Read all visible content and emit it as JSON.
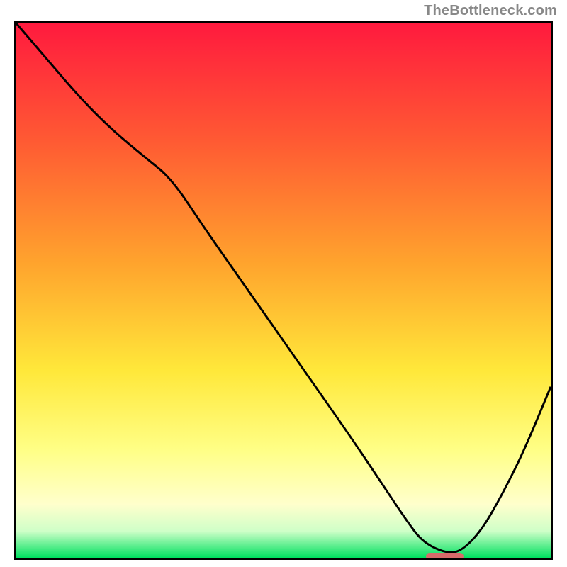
{
  "watermark": "TheBottleneck.com",
  "chart_data": {
    "type": "line",
    "title": "",
    "xlabel": "",
    "ylabel": "",
    "xlim": [
      0,
      100
    ],
    "ylim": [
      0,
      100
    ],
    "grid": false,
    "legend": false,
    "background_gradient_stops": [
      {
        "offset": 0,
        "color": "#ff1a3e"
      },
      {
        "offset": 22,
        "color": "#ff5a33"
      },
      {
        "offset": 45,
        "color": "#ffa42d"
      },
      {
        "offset": 65,
        "color": "#ffe83a"
      },
      {
        "offset": 80,
        "color": "#ffff87"
      },
      {
        "offset": 90,
        "color": "#ffffcc"
      },
      {
        "offset": 95,
        "color": "#cfffc8"
      },
      {
        "offset": 100,
        "color": "#00e060"
      }
    ],
    "series": [
      {
        "name": "curve",
        "x": [
          0,
          6,
          12,
          18,
          24,
          29,
          35,
          42,
          49,
          56,
          63,
          69,
          73,
          76,
          80,
          83,
          87,
          91,
          95,
          100
        ],
        "y": [
          100,
          93,
          86,
          80,
          75,
          71,
          62,
          52,
          42,
          32,
          22,
          13,
          7,
          3,
          1,
          1,
          5,
          12,
          20,
          32
        ]
      }
    ],
    "marker": {
      "x_start": 76,
      "x_end": 83,
      "y": 1,
      "color": "#d86a6a"
    }
  }
}
